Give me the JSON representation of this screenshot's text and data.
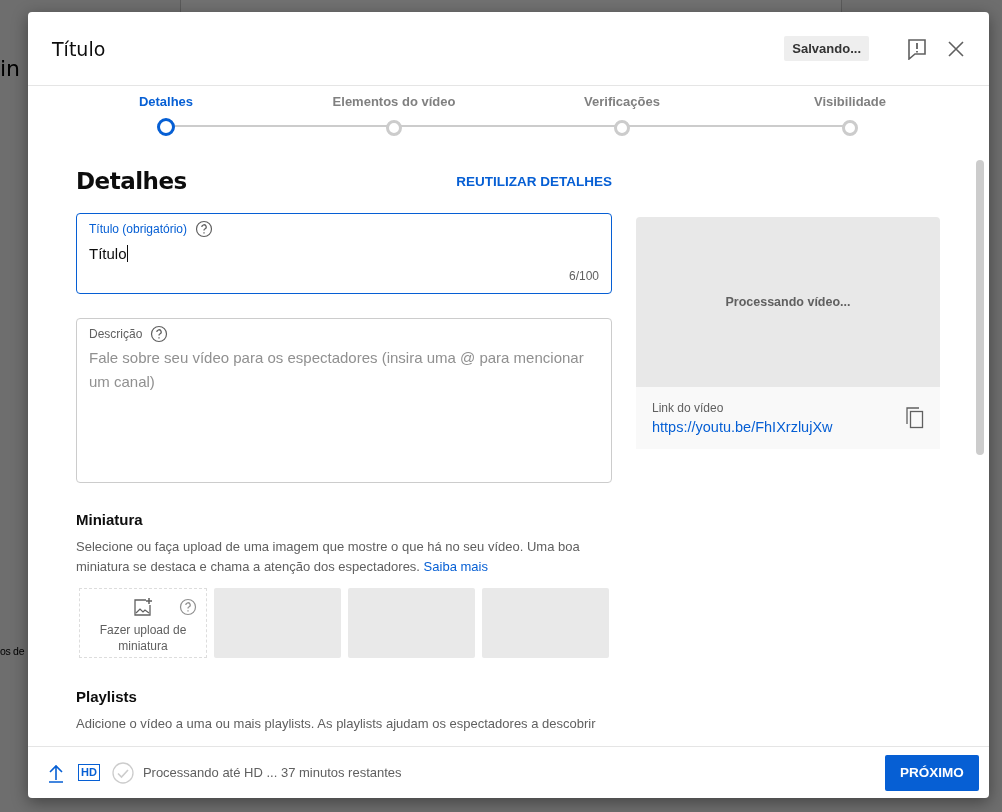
{
  "background": {
    "fragments": [
      {
        "text": "in",
        "kind": "heading"
      },
      {
        "text": "os de",
        "kind": "text"
      }
    ]
  },
  "dialog": {
    "title": "Título",
    "status_badge": "Salvando..."
  },
  "steps": [
    {
      "label": "Detalhes",
      "selected": true
    },
    {
      "label": "Elementos do vídeo",
      "selected": false
    },
    {
      "label": "Verificações",
      "selected": false
    },
    {
      "label": "Visibilidade",
      "selected": false
    }
  ],
  "details": {
    "heading": "Detalhes",
    "reuse_link": "REUTILIZAR DETALHES",
    "title_field": {
      "label": "Título (obrigatório)",
      "value": "Título",
      "counter": "6/100",
      "focused": true
    },
    "description_field": {
      "label": "Descrição",
      "placeholder": "Fale sobre seu vídeo para os espectadores (insira uma @ para mencionar um canal)",
      "focused": false
    }
  },
  "thumbnail": {
    "heading": "Miniatura",
    "text": "Selecione ou faça upload de uma imagem que mostre o que há no seu vídeo. Uma boa miniatura se destaca e chama a atenção dos espectadores.",
    "link": "Saiba mais",
    "upload_label": "Fazer upload de miniatura",
    "suggestions": [
      {
        "kind": "placeholder"
      },
      {
        "kind": "placeholder"
      },
      {
        "kind": "placeholder"
      }
    ]
  },
  "playlists": {
    "heading": "Playlists",
    "text": "Adicione o vídeo a uma ou mais playlists. As playlists ajudam os espectadores a descobrir"
  },
  "preview": {
    "status": "Processando vídeo...",
    "link_label": "Link do vídeo",
    "link": "https://youtu.be/FhIXrzlujXw"
  },
  "footer": {
    "quality_badge": "HD",
    "status": "Processando até HD ... 37 minutos restantes",
    "next_button": "PRÓXIMO"
  }
}
